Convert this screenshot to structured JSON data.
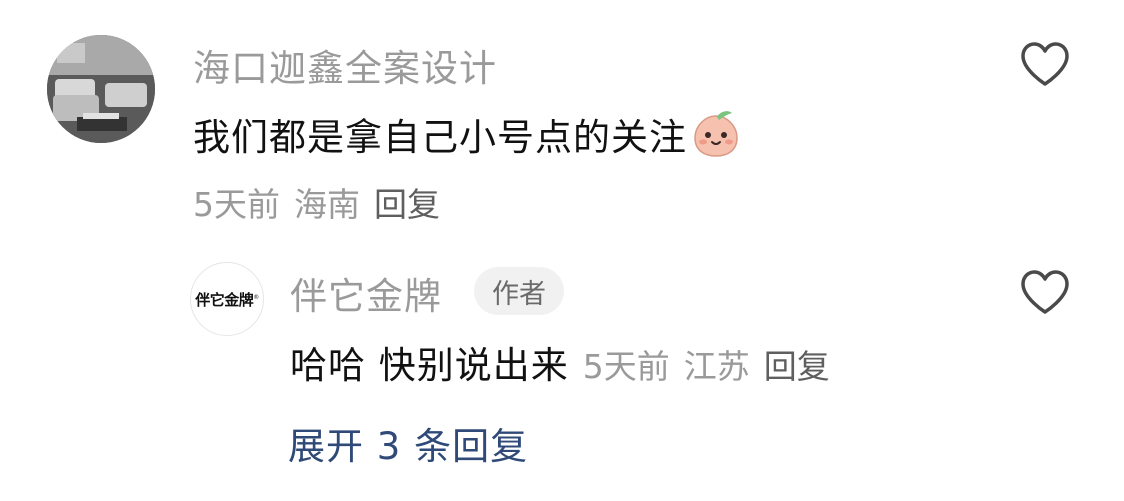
{
  "comments": [
    {
      "author": "海口迦鑫全案设计",
      "text": "我们都是拿自己小号点的关注",
      "emoji_icon": "smiling-peach-emoji",
      "time": "5天前",
      "location": "海南",
      "reply_label": "回复",
      "like_icon": "heart-outline-icon"
    },
    {
      "author": "伴它金牌",
      "author_badge": "作者",
      "avatar_logo_text": "伴它金牌",
      "avatar_logo_mark": "®",
      "text": "哈哈 快别说出来",
      "time": "5天前",
      "location": "江苏",
      "reply_label": "回复",
      "like_icon": "heart-outline-icon"
    }
  ],
  "expand_replies_label": "展开 3 条回复",
  "colors": {
    "meta_gray": "#9a9a9a",
    "reply_gray": "#5f5f5f",
    "link_blue": "#2f4a78",
    "badge_bg": "#f1f1f1"
  }
}
